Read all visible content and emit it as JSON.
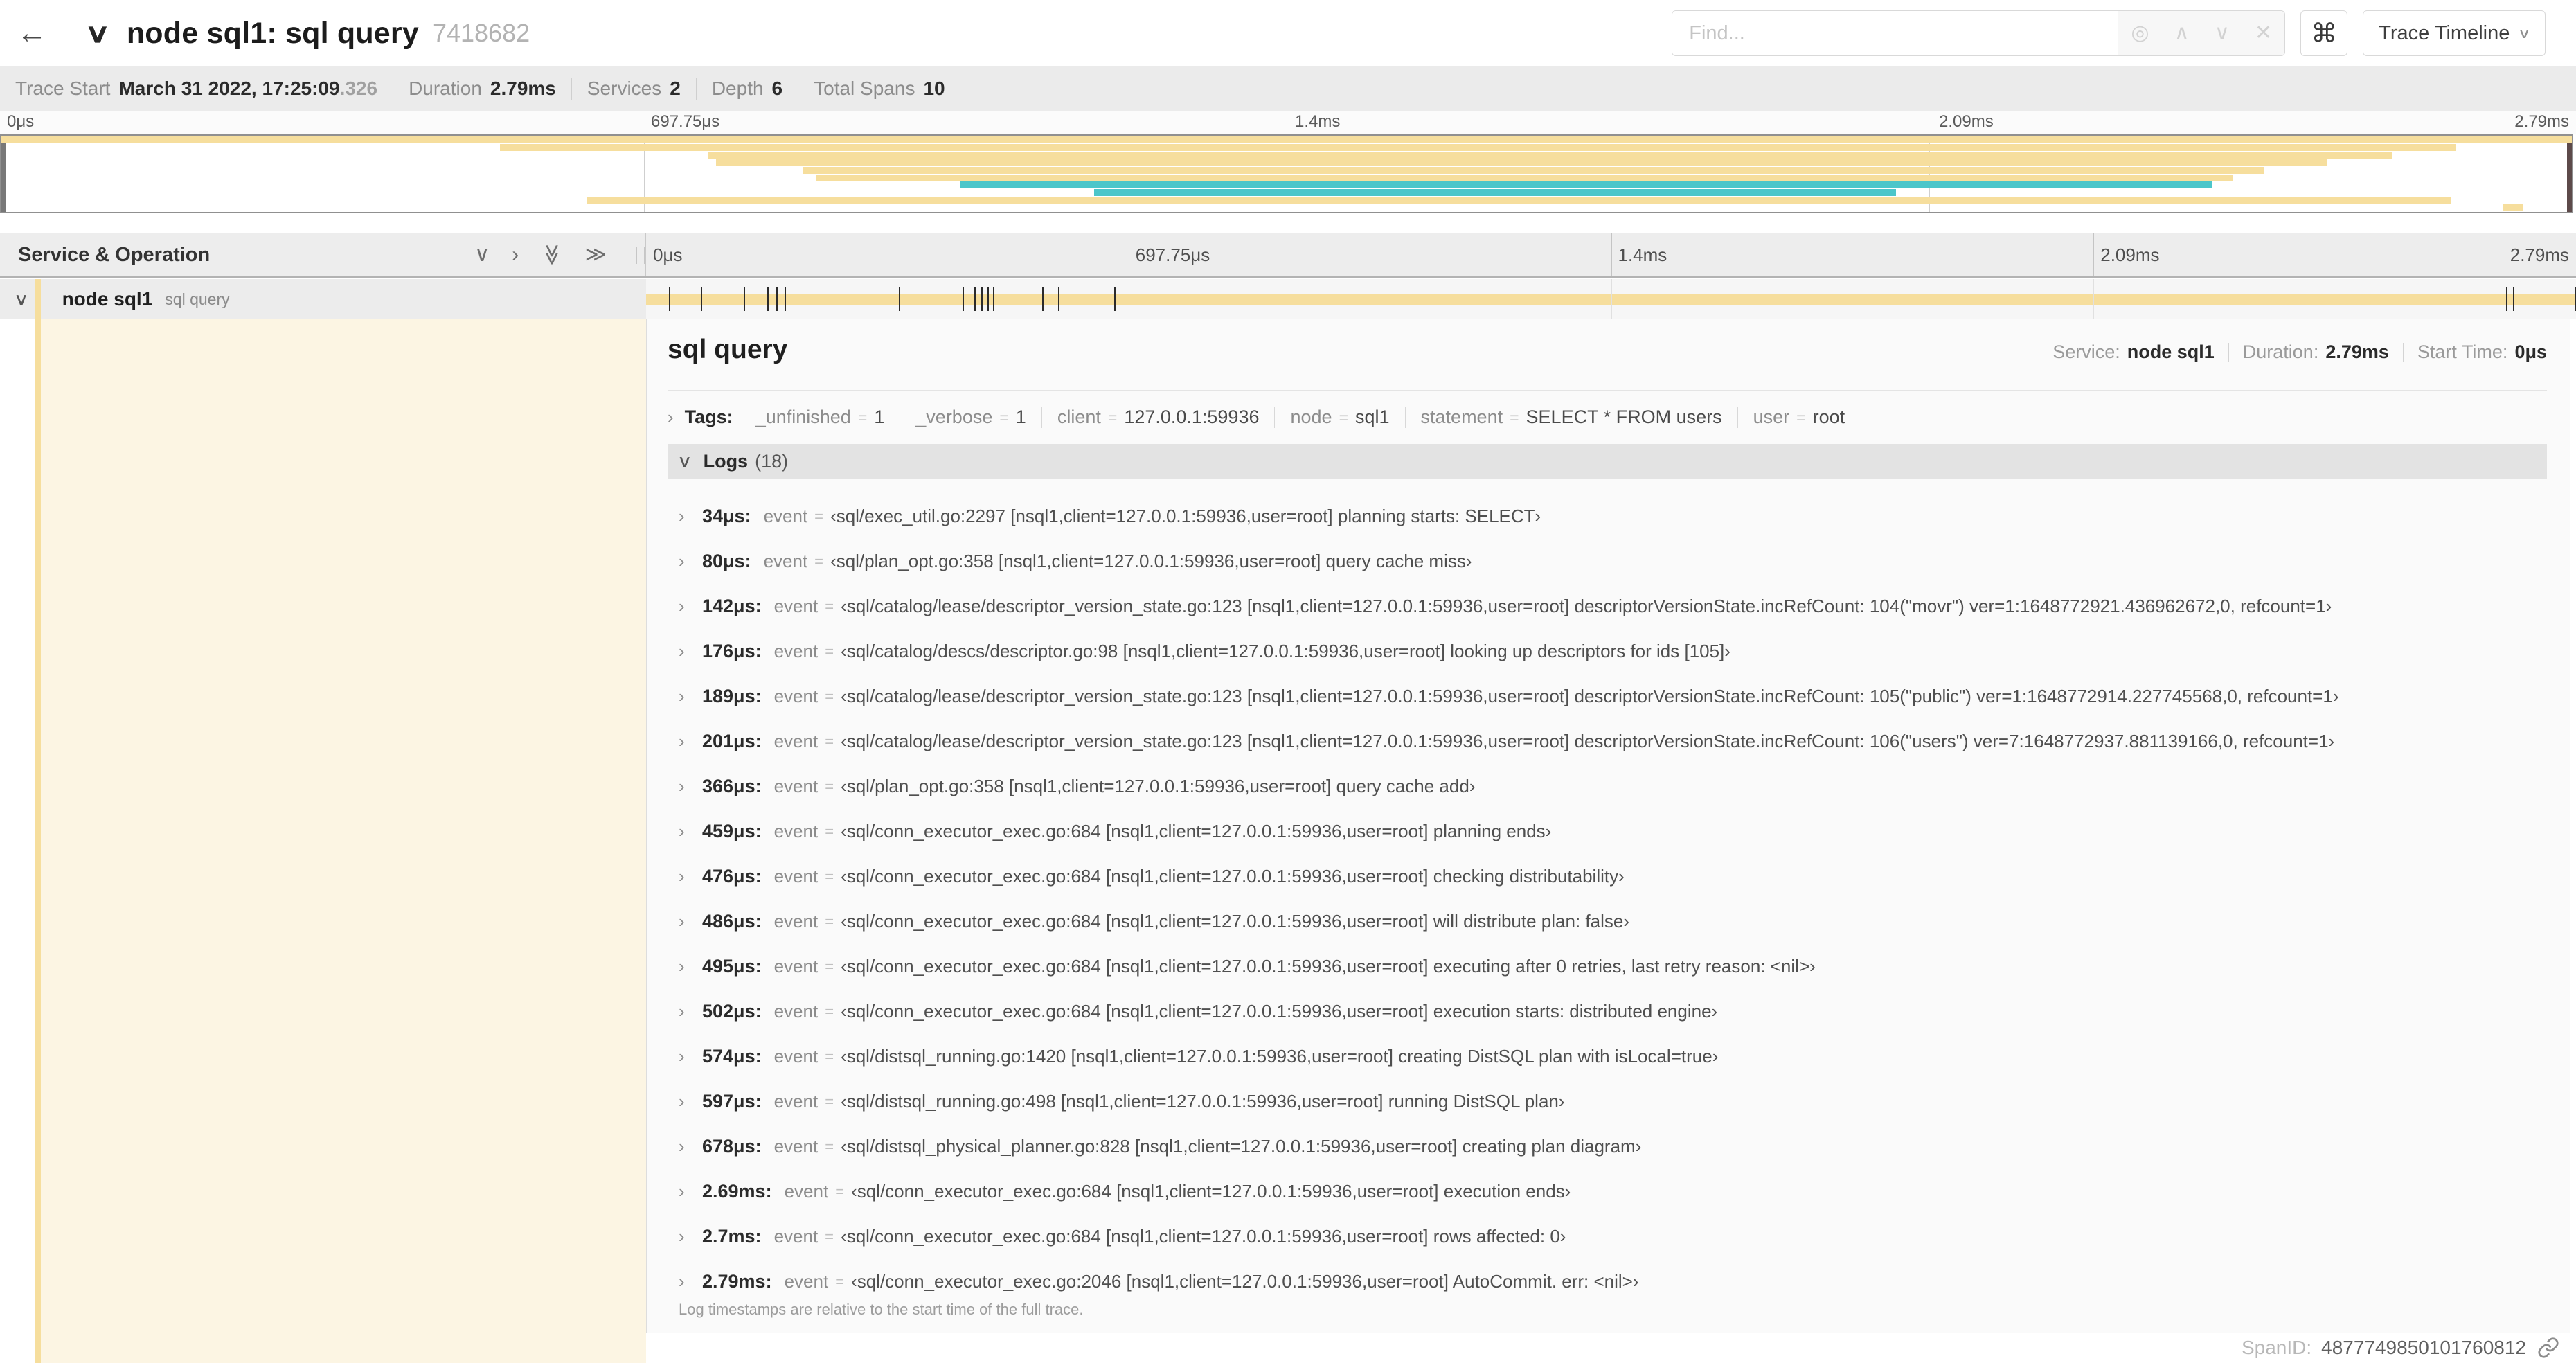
{
  "colors": {
    "span_tan": "#F6DE9D",
    "span_teal": "#4CC6CA",
    "accent_cream": "#FCF5E3"
  },
  "topbar": {
    "back_icon": "←",
    "collapse_icon": "∨",
    "title": "node sql1: sql query",
    "trace_id": "7418682",
    "find_placeholder": "Find...",
    "locate_icon": "◎",
    "prev_icon": "∧",
    "next_icon": "∨",
    "clear_icon": "✕",
    "shortcut_icon": "⌘",
    "view_label": "Trace Timeline",
    "view_caret": "∨"
  },
  "trace_info": {
    "trace_start_label": "Trace Start",
    "trace_start_value": "March 31 2022, 17:25:09",
    "trace_start_fraction": ".326",
    "duration_label": "Duration",
    "duration_value": "2.79ms",
    "services_label": "Services",
    "services_value": "2",
    "depth_label": "Depth",
    "depth_value": "6",
    "total_spans_label": "Total Spans",
    "total_spans_value": "10"
  },
  "minimap": {
    "labels": [
      {
        "text": "0μs",
        "pos": 0
      },
      {
        "text": "697.75μs",
        "pos": 25
      },
      {
        "text": "1.4ms",
        "pos": 50
      },
      {
        "text": "2.09ms",
        "pos": 75
      },
      {
        "text": "2.79ms",
        "pos": 100
      }
    ],
    "spans": [
      {
        "start": 0,
        "end": 100,
        "color": "tan"
      },
      {
        "start": 19.4,
        "end": 95.5,
        "color": "tan"
      },
      {
        "start": 27.5,
        "end": 93.0,
        "color": "tan"
      },
      {
        "start": 27.8,
        "end": 90.5,
        "color": "tan"
      },
      {
        "start": 31.2,
        "end": 88.0,
        "color": "tan"
      },
      {
        "start": 31.7,
        "end": 86.8,
        "color": "tan"
      },
      {
        "start": 37.3,
        "end": 86.0,
        "color": "teal"
      },
      {
        "start": 42.5,
        "end": 73.7,
        "color": "teal"
      },
      {
        "start": 22.8,
        "end": 95.3,
        "color": "tan"
      },
      {
        "start": 97.3,
        "end": 98.1,
        "color": "tan"
      }
    ]
  },
  "timeline": {
    "header_label": "Service & Operation",
    "collapse_down_icon": "∨",
    "collapse_right_icon": "›",
    "collapse_all_down_icon": "≫",
    "collapse_all_right_icon": "≫",
    "ticks": [
      {
        "text": "0μs",
        "pos": 0
      },
      {
        "text": "697.75μs",
        "pos": 25
      },
      {
        "text": "1.4ms",
        "pos": 50
      },
      {
        "text": "2.09ms",
        "pos": 75
      },
      {
        "text": "2.79ms",
        "pos": 100
      }
    ]
  },
  "span_row": {
    "collapse_icon": "∨",
    "service": "node sql1",
    "operation": "sql query",
    "marker_positions": [
      1.22,
      2.87,
      5.09,
      6.31,
      6.77,
      7.2,
      13.12,
      16.45,
      17.06,
      17.42,
      17.74,
      18.0,
      20.57,
      21.4,
      24.3,
      96.4,
      96.77,
      100
    ]
  },
  "detail": {
    "title": "sql query",
    "service_label": "Service:",
    "service_value": "node sql1",
    "duration_label": "Duration:",
    "duration_value": "2.79ms",
    "start_time_label": "Start Time:",
    "start_time_value": "0μs",
    "tags_toggle_icon": "›",
    "tags_label": "Tags:",
    "tag_eq": "=",
    "tags": [
      {
        "key": "_unfinished",
        "value": "1"
      },
      {
        "key": "_verbose",
        "value": "1"
      },
      {
        "key": "client",
        "value": "127.0.0.1:59936"
      },
      {
        "key": "node",
        "value": "sql1"
      },
      {
        "key": "statement",
        "value": "SELECT * FROM users"
      },
      {
        "key": "user",
        "value": "root"
      }
    ],
    "logs_toggle_icon": "∨",
    "logs_label": "Logs",
    "logs_count": "(18)",
    "log_row_icon": "›",
    "log_event_key": "event",
    "log_eq": "=",
    "log_quote_open": "‹",
    "log_quote_close": "›",
    "log_colon": ":",
    "logs": [
      {
        "time": "34μs",
        "message": "sql/exec_util.go:2297 [nsql1,client=127.0.0.1:59936,user=root] planning starts: SELECT"
      },
      {
        "time": "80μs",
        "message": "sql/plan_opt.go:358 [nsql1,client=127.0.0.1:59936,user=root] query cache miss"
      },
      {
        "time": "142μs",
        "message": "sql/catalog/lease/descriptor_version_state.go:123 [nsql1,client=127.0.0.1:59936,user=root] descriptorVersionState.incRefCount: 104(\"movr\") ver=1:1648772921.436962672,0, refcount=1"
      },
      {
        "time": "176μs",
        "message": "sql/catalog/descs/descriptor.go:98 [nsql1,client=127.0.0.1:59936,user=root] looking up descriptors for ids [105]"
      },
      {
        "time": "189μs",
        "message": "sql/catalog/lease/descriptor_version_state.go:123 [nsql1,client=127.0.0.1:59936,user=root] descriptorVersionState.incRefCount: 105(\"public\") ver=1:1648772914.227745568,0, refcount=1"
      },
      {
        "time": "201μs",
        "message": "sql/catalog/lease/descriptor_version_state.go:123 [nsql1,client=127.0.0.1:59936,user=root] descriptorVersionState.incRefCount: 106(\"users\") ver=7:1648772937.881139166,0, refcount=1"
      },
      {
        "time": "366μs",
        "message": "sql/plan_opt.go:358 [nsql1,client=127.0.0.1:59936,user=root] query cache add"
      },
      {
        "time": "459μs",
        "message": "sql/conn_executor_exec.go:684 [nsql1,client=127.0.0.1:59936,user=root] planning ends"
      },
      {
        "time": "476μs",
        "message": "sql/conn_executor_exec.go:684 [nsql1,client=127.0.0.1:59936,user=root] checking distributability"
      },
      {
        "time": "486μs",
        "message": "sql/conn_executor_exec.go:684 [nsql1,client=127.0.0.1:59936,user=root] will distribute plan: false"
      },
      {
        "time": "495μs",
        "message": "sql/conn_executor_exec.go:684 [nsql1,client=127.0.0.1:59936,user=root] executing after 0 retries, last retry reason: <nil>"
      },
      {
        "time": "502μs",
        "message": "sql/conn_executor_exec.go:684 [nsql1,client=127.0.0.1:59936,user=root] execution starts: distributed engine"
      },
      {
        "time": "574μs",
        "message": "sql/distsql_running.go:1420 [nsql1,client=127.0.0.1:59936,user=root] creating DistSQL plan with isLocal=true"
      },
      {
        "time": "597μs",
        "message": "sql/distsql_running.go:498 [nsql1,client=127.0.0.1:59936,user=root] running DistSQL plan"
      },
      {
        "time": "678μs",
        "message": "sql/distsql_physical_planner.go:828 [nsql1,client=127.0.0.1:59936,user=root] creating plan diagram"
      },
      {
        "time": "2.69ms",
        "message": "sql/conn_executor_exec.go:684 [nsql1,client=127.0.0.1:59936,user=root] execution ends"
      },
      {
        "time": "2.7ms",
        "message": "sql/conn_executor_exec.go:684 [nsql1,client=127.0.0.1:59936,user=root] rows affected: 0"
      },
      {
        "time": "2.79ms",
        "message": "sql/conn_executor_exec.go:2046 [nsql1,client=127.0.0.1:59936,user=root] AutoCommit. err: <nil>"
      }
    ],
    "logs_footnote": "Log timestamps are relative to the start time of the full trace.",
    "span_id_label": "SpanID:",
    "span_id_value": "4877749850101760812"
  }
}
